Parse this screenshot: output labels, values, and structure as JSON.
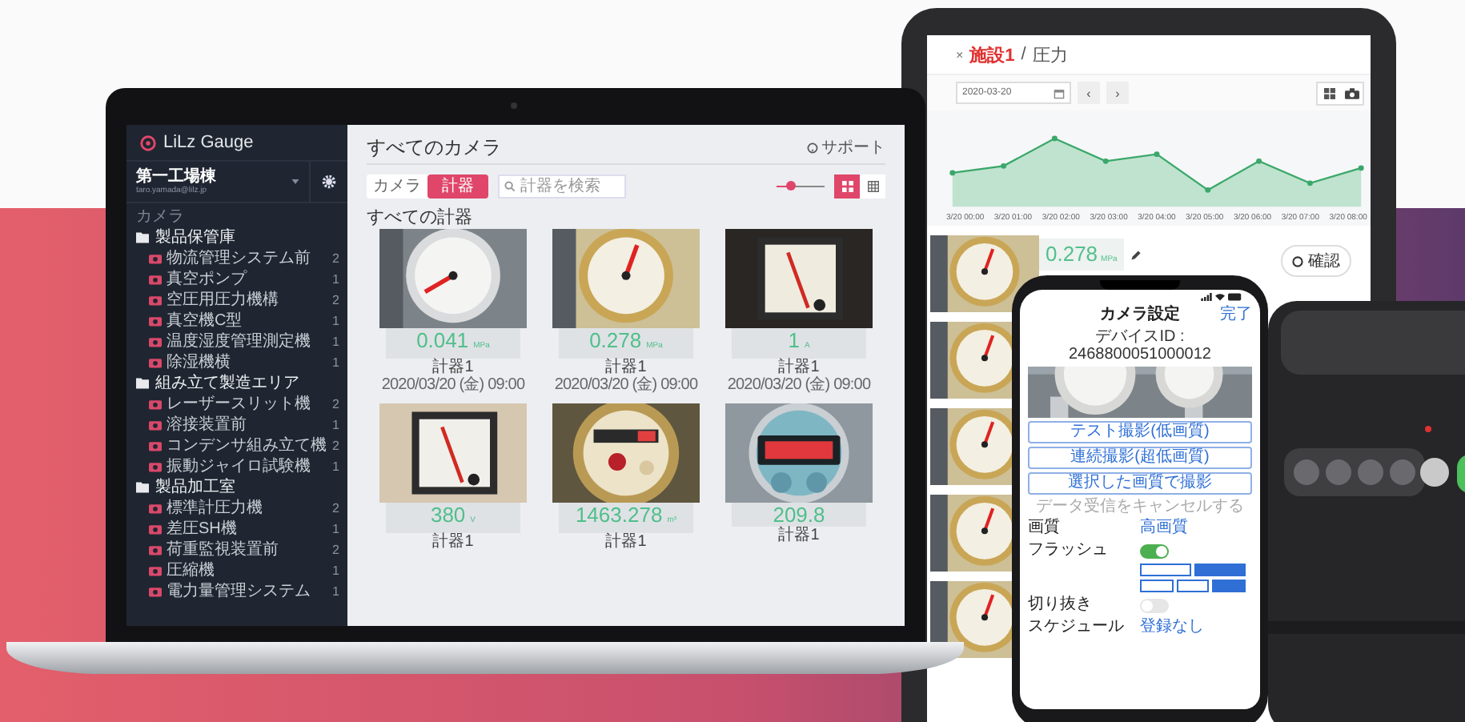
{
  "laptop": {
    "sidebar": {
      "logo": "LiLz Gauge",
      "account": {
        "name": "第一工場棟",
        "email": "taro.yamada@lilz.jp"
      },
      "section_label": "カメラ",
      "tree": [
        {
          "label": "製品保管庫",
          "children": [
            {
              "label": "物流管理システム前",
              "count": "2"
            },
            {
              "label": "真空ポンプ",
              "count": "1"
            },
            {
              "label": "空圧用圧力機構",
              "count": "2"
            },
            {
              "label": "真空機C型",
              "count": "1"
            },
            {
              "label": "温度湿度管理測定機",
              "count": "1"
            },
            {
              "label": "除湿機横",
              "count": "1"
            }
          ]
        },
        {
          "label": "組み立て製造エリア",
          "children": [
            {
              "label": "レーザースリット機",
              "count": "2"
            },
            {
              "label": "溶接装置前",
              "count": "1"
            },
            {
              "label": "コンデンサ組み立て機",
              "count": "2"
            },
            {
              "label": "振動ジャイロ試験機",
              "count": "1"
            }
          ]
        },
        {
          "label": "製品加工室",
          "children": [
            {
              "label": "標準計圧力機",
              "count": "2"
            },
            {
              "label": "差圧SH機",
              "count": "1"
            },
            {
              "label": "荷重監視装置前",
              "count": "2"
            },
            {
              "label": "圧縮機",
              "count": "1"
            },
            {
              "label": "電力量管理システム",
              "count": "1"
            }
          ]
        }
      ]
    },
    "main": {
      "title": "すべてのカメラ",
      "support_link": "サポート",
      "tabs": [
        {
          "label": "カメラ",
          "selected": false
        },
        {
          "label": "計器",
          "selected": true
        }
      ],
      "search": {
        "placeholder": "計器を検索"
      },
      "zoom_slider": {
        "level": 0.3
      },
      "view_buttons": [
        {
          "kind": "large-grid",
          "selected": true
        },
        {
          "kind": "small-grid",
          "selected": false
        }
      ],
      "section_title": "すべての計器",
      "gauges": [
        {
          "reading": "0.041",
          "unit": "MPa",
          "label": "計器1",
          "timestamp": "2020/03/20 (金) 09:00"
        },
        {
          "reading": "0.278",
          "unit": "MPa",
          "label": "計器1",
          "timestamp": "2020/03/20 (金) 09:00"
        },
        {
          "reading": "1",
          "unit": "A",
          "label": "計器1",
          "timestamp": "2020/03/20 (金) 09:00"
        },
        {
          "reading": "380",
          "unit": "V",
          "label": "計器1"
        },
        {
          "reading": "1463.278",
          "unit": "m³",
          "label": "計器1"
        },
        {
          "reading": "209.8",
          "label": "計器1"
        }
      ]
    }
  },
  "tablet": {
    "close": "×",
    "breadcrumb": [
      {
        "label": "施設1",
        "kind": "facility"
      },
      {
        "label": "/",
        "kind": "separator"
      },
      {
        "label": "圧力",
        "kind": "page"
      }
    ],
    "date": "2020-03-20",
    "nav_buttons": [
      "‹",
      "›"
    ],
    "view_buttons": [
      {
        "kind": "table"
      },
      {
        "kind": "camera"
      }
    ],
    "chart_labels": [
      "3/20 00:00",
      "3/20 01:00",
      "3/20 02:00",
      "3/20 03:00",
      "3/20 04:00",
      "3/20 05:00",
      "3/20 06:00",
      "3/20 07:00",
      "3/20 08:00"
    ],
    "reading": "0.278",
    "unit": "MPa",
    "confirm_button": "確認"
  },
  "phone": {
    "title": "カメラ設定",
    "done": "完了",
    "device_id": "デバイスID : 2468800051000012",
    "buttons": [
      "テスト撮影(低画質)",
      "連続撮影(超低画質)",
      "選択した画質で撮影"
    ],
    "cancel_link": "データ受信をキャンセルする",
    "settings": [
      {
        "kind": "value",
        "label": "画質",
        "value": "高画質"
      },
      {
        "kind": "toggle",
        "label": "フラッシュ",
        "on": true
      },
      {
        "kind": "segments",
        "options": [
          {
            "selected": false
          },
          {
            "selected": true
          }
        ]
      },
      {
        "kind": "segments",
        "options": [
          {
            "selected": false
          },
          {
            "selected": false
          },
          {
            "selected": true
          }
        ]
      },
      {
        "kind": "toggle",
        "label": "切り抜き",
        "on": false
      },
      {
        "kind": "value",
        "label": "スケジュール",
        "value": "登録なし"
      }
    ]
  }
}
